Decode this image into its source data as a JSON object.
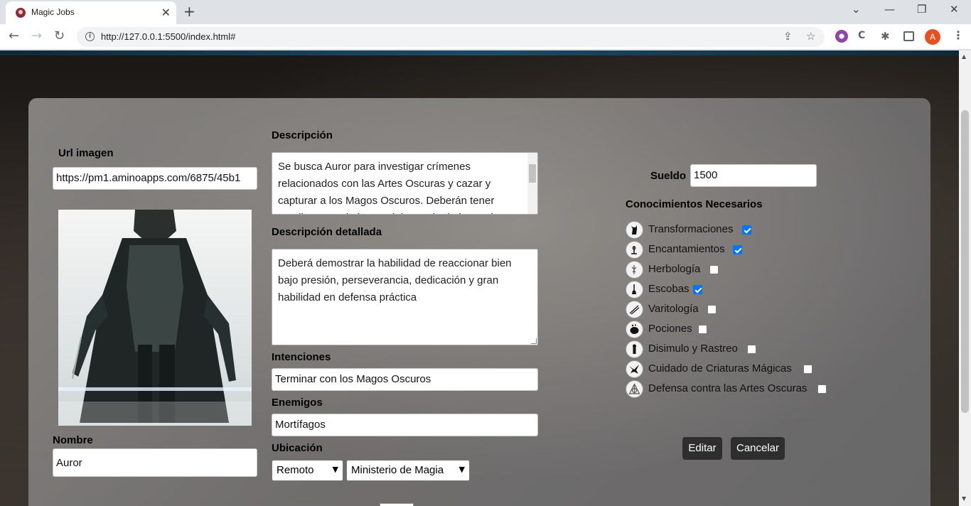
{
  "browser": {
    "tab_title": "Magic Jobs",
    "url": "http://127.0.0.1:5500/index.html#",
    "profile_initial": "A"
  },
  "form": {
    "url_label": "Url imagen",
    "url_value": "https://pm1.aminoapps.com/6875/45b1",
    "description_label": "Descripción",
    "description_value": "Se busca Auror para investigar crímenes relacionados con las Artes Oscuras y cazar y capturar a los Magos Oscuros. Deberán tener amplios conocimientos del manejo de la Magia",
    "detailed_label": "Descripción detallada",
    "detailed_value": "Deberá demostrar la habilidad de reaccionar bien bajo presión, perseverancia, dedicación y gran habilidad en defensa práctica",
    "intentions_label": "Intenciones",
    "intentions_value": "Terminar con los Magos Oscuros",
    "enemies_label": "Enemigos",
    "enemies_value": "Mortífagos",
    "location_label": "Ubicación",
    "location_mode": "Remoto",
    "location_place": "Ministerio de Magia",
    "name_label": "Nombre",
    "name_value": "Auror",
    "salary_label": "Sueldo",
    "salary_value": "1500",
    "skills_label": "Conocimientos Necesarios"
  },
  "skills": [
    {
      "label": "Transformaciones",
      "checked": true,
      "icon": "cat-icon"
    },
    {
      "label": "Encantamientos",
      "checked": true,
      "icon": "wand-spark-icon"
    },
    {
      "label": "Herbología",
      "checked": false,
      "icon": "mandrake-icon"
    },
    {
      "label": "Escobas",
      "checked": true,
      "icon": "broom-icon"
    },
    {
      "label": "Varitología",
      "checked": false,
      "icon": "wands-icon"
    },
    {
      "label": "Pociones",
      "checked": false,
      "icon": "cauldron-icon"
    },
    {
      "label": "Disimulo y Rastreo",
      "checked": false,
      "icon": "keyhole-icon"
    },
    {
      "label": "Cuidado de Criaturas Mágicas",
      "checked": false,
      "icon": "hippogriff-icon"
    },
    {
      "label": "Defensa contra las Artes Oscuras",
      "checked": false,
      "icon": "deathly-hallows-icon"
    }
  ],
  "actions": {
    "edit": "Editar",
    "cancel": "Cancelar"
  },
  "colors": {
    "checkbox_on": "#0075ff",
    "button_bg": "#2e2e2e",
    "profile": "#e8501f"
  }
}
